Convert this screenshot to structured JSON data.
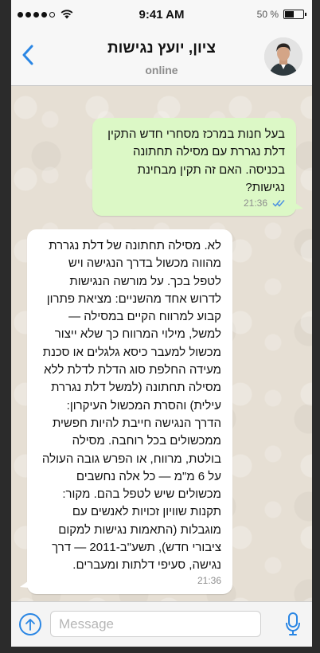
{
  "status_bar": {
    "time": "9:41 AM",
    "battery_label": "50 %",
    "battery_level": 0.5,
    "signal_dots_filled": 4,
    "signal_dots_total": 5
  },
  "header": {
    "contact_name": "ציון, יועץ נגישות",
    "status": "online",
    "accent_color": "#2a86e4"
  },
  "messages": [
    {
      "direction": "outgoing",
      "text": "בעל חנות במרכז מסחרי חדש התקין דלת נגררת עם מסילה תחתונה בכניסה. האם זה תקין מבחינת נגישות?",
      "time": "21:36",
      "read": true
    },
    {
      "direction": "incoming",
      "text": "לא. מסילה תחתונה של דלת נגררת מהווה מכשול בדרך הנגישה ויש לטפל בכך. על מורשה הנגישות לדרוש אחד מהשניים: מציאת פתרון קבוע למרווח הקיים במסילה — למשל, מילוי המרווח כך שלא ייצור מכשול למעבר כיסא גלגלים או סכנת מעידה החלפת סוג הדלת לדלת ללא מסילה תחתונה (למשל דלת נגררת עילית) והסרת המכשול העיקרון: הדרך הנגישה חייבת להיות חפשית ממכשולים בכל רוחבה. מסילה בולטת, מרווח, או הפרש גובה העולה על 6 מ\"מ — כל אלה נחשבים מכשולים שיש לטפל בהם. מקור: תקנות שוויון זכויות לאנשים עם מוגבלות (התאמות נגישות למקום ציבורי חדש), תשע\"ב-2011 — דרך נגישה, סעיפי דלתות ומעברים.",
      "time": "21:36"
    }
  ],
  "input_bar": {
    "placeholder": "Message"
  },
  "colors": {
    "outgoing_bubble": "#dcf8c6",
    "incoming_bubble": "#ffffff",
    "read_ticks": "#4a90e2"
  }
}
